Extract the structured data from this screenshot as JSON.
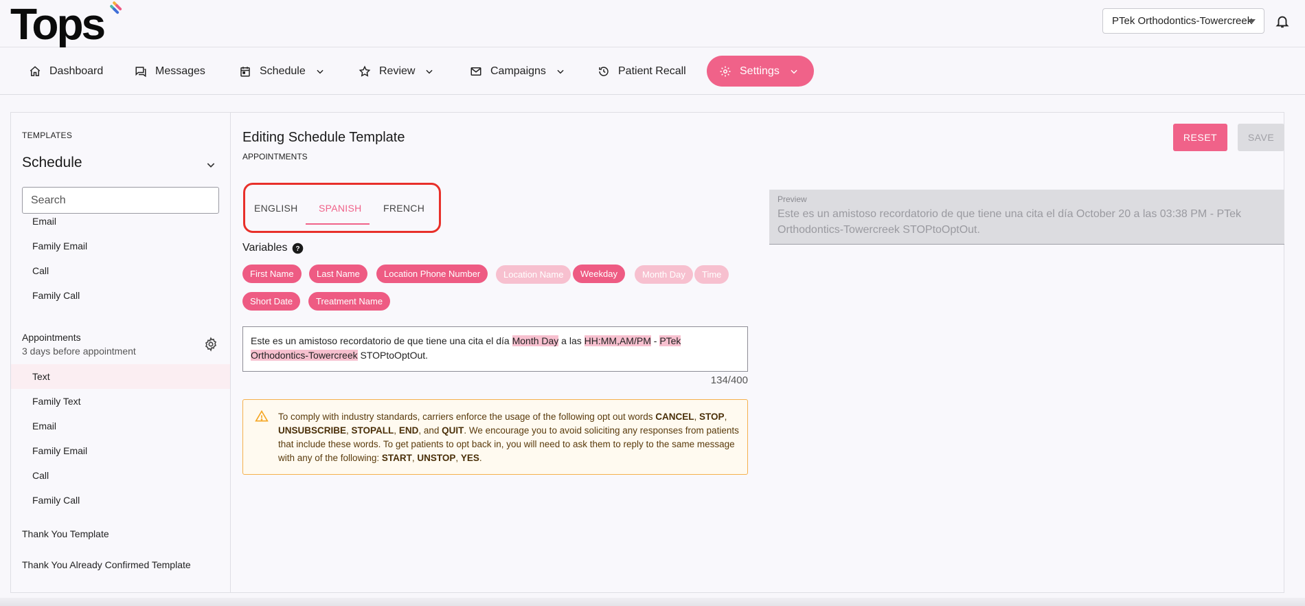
{
  "app": {
    "logo_text": "Tops"
  },
  "header": {
    "location": "PTek Orthodontics-Towercreek"
  },
  "nav": {
    "dashboard": "Dashboard",
    "messages": "Messages",
    "schedule": "Schedule",
    "review": "Review",
    "campaigns": "Campaigns",
    "patient_recall": "Patient Recall",
    "settings": "Settings"
  },
  "sidebar": {
    "heading": "TEMPLATES",
    "section": "Schedule",
    "search_placeholder": "Search",
    "items_top": [
      "Email",
      "Family Email",
      "Call",
      "Family Call"
    ],
    "group_title": "Appointments",
    "group_subtitle": "3 days before appointment",
    "group_items": [
      "Text",
      "Family Text",
      "Email",
      "Family Email",
      "Call",
      "Family Call"
    ],
    "active_item": "Text",
    "roots": [
      "Thank You Template",
      "Thank You Already Confirmed Template"
    ]
  },
  "editor": {
    "title": "Editing Schedule Template",
    "subtitle": "APPOINTMENTS",
    "reset_label": "RESET",
    "save_label": "SAVE",
    "tabs": [
      "ENGLISH",
      "SPANISH",
      "FRENCH"
    ],
    "active_tab": "SPANISH",
    "variables_label": "Variables",
    "variables": [
      {
        "label": "First Name",
        "enabled": true
      },
      {
        "label": "Last Name",
        "enabled": true
      },
      {
        "label": "Location Phone Number",
        "enabled": true
      },
      {
        "label": "Location Name",
        "enabled": false
      },
      {
        "label": "Weekday",
        "enabled": true
      },
      {
        "label": "Month Day",
        "enabled": false
      },
      {
        "label": "Time",
        "enabled": false
      },
      {
        "label": "Short Date",
        "enabled": true
      },
      {
        "label": "Treatment Name",
        "enabled": true
      }
    ],
    "message": {
      "part1": "Este es un amistoso recordatorio de que tiene una cita el día ",
      "var1": "Month Day",
      "part2": " a las ",
      "var2": "HH:MM,AM/PM",
      "part3": " - ",
      "var3": "PTek Orthodontics-Towercreek",
      "part4": " STOPtoOptOut."
    },
    "char_count": "134/400",
    "warning": {
      "t1": "To comply with industry standards, carriers enforce the usage of the following opt out words ",
      "w1": "CANCEL",
      "t2": ", ",
      "w2": "STOP",
      "t3": ", ",
      "w3": "UNSUBSCRIBE",
      "t4": ", ",
      "w4": "STOPALL",
      "t5": ", ",
      "w5": "END",
      "t6": ", and ",
      "w6": "QUIT",
      "t7": ". We encourage you to avoid soliciting any responses from patients that include these words. To get patients to opt back in, you will need to ask them to reply to the same message with any of the following: ",
      "w7": "START",
      "t8": ", ",
      "w8": "UNSTOP",
      "t9": ", ",
      "w9": "YES",
      "t10": "."
    },
    "preview_label": "Preview",
    "preview_text": "Este es un amistoso recordatorio de que tiene una cita el día October 20 a las 03:38 PM - PTek Orthodontics-Towercreek STOPtoOptOut."
  },
  "colors": {
    "accent": "#f06289",
    "chip_disabled": "#f7c0cf",
    "highlight_box": "#e8302a",
    "warning_border": "#f5b04c"
  }
}
